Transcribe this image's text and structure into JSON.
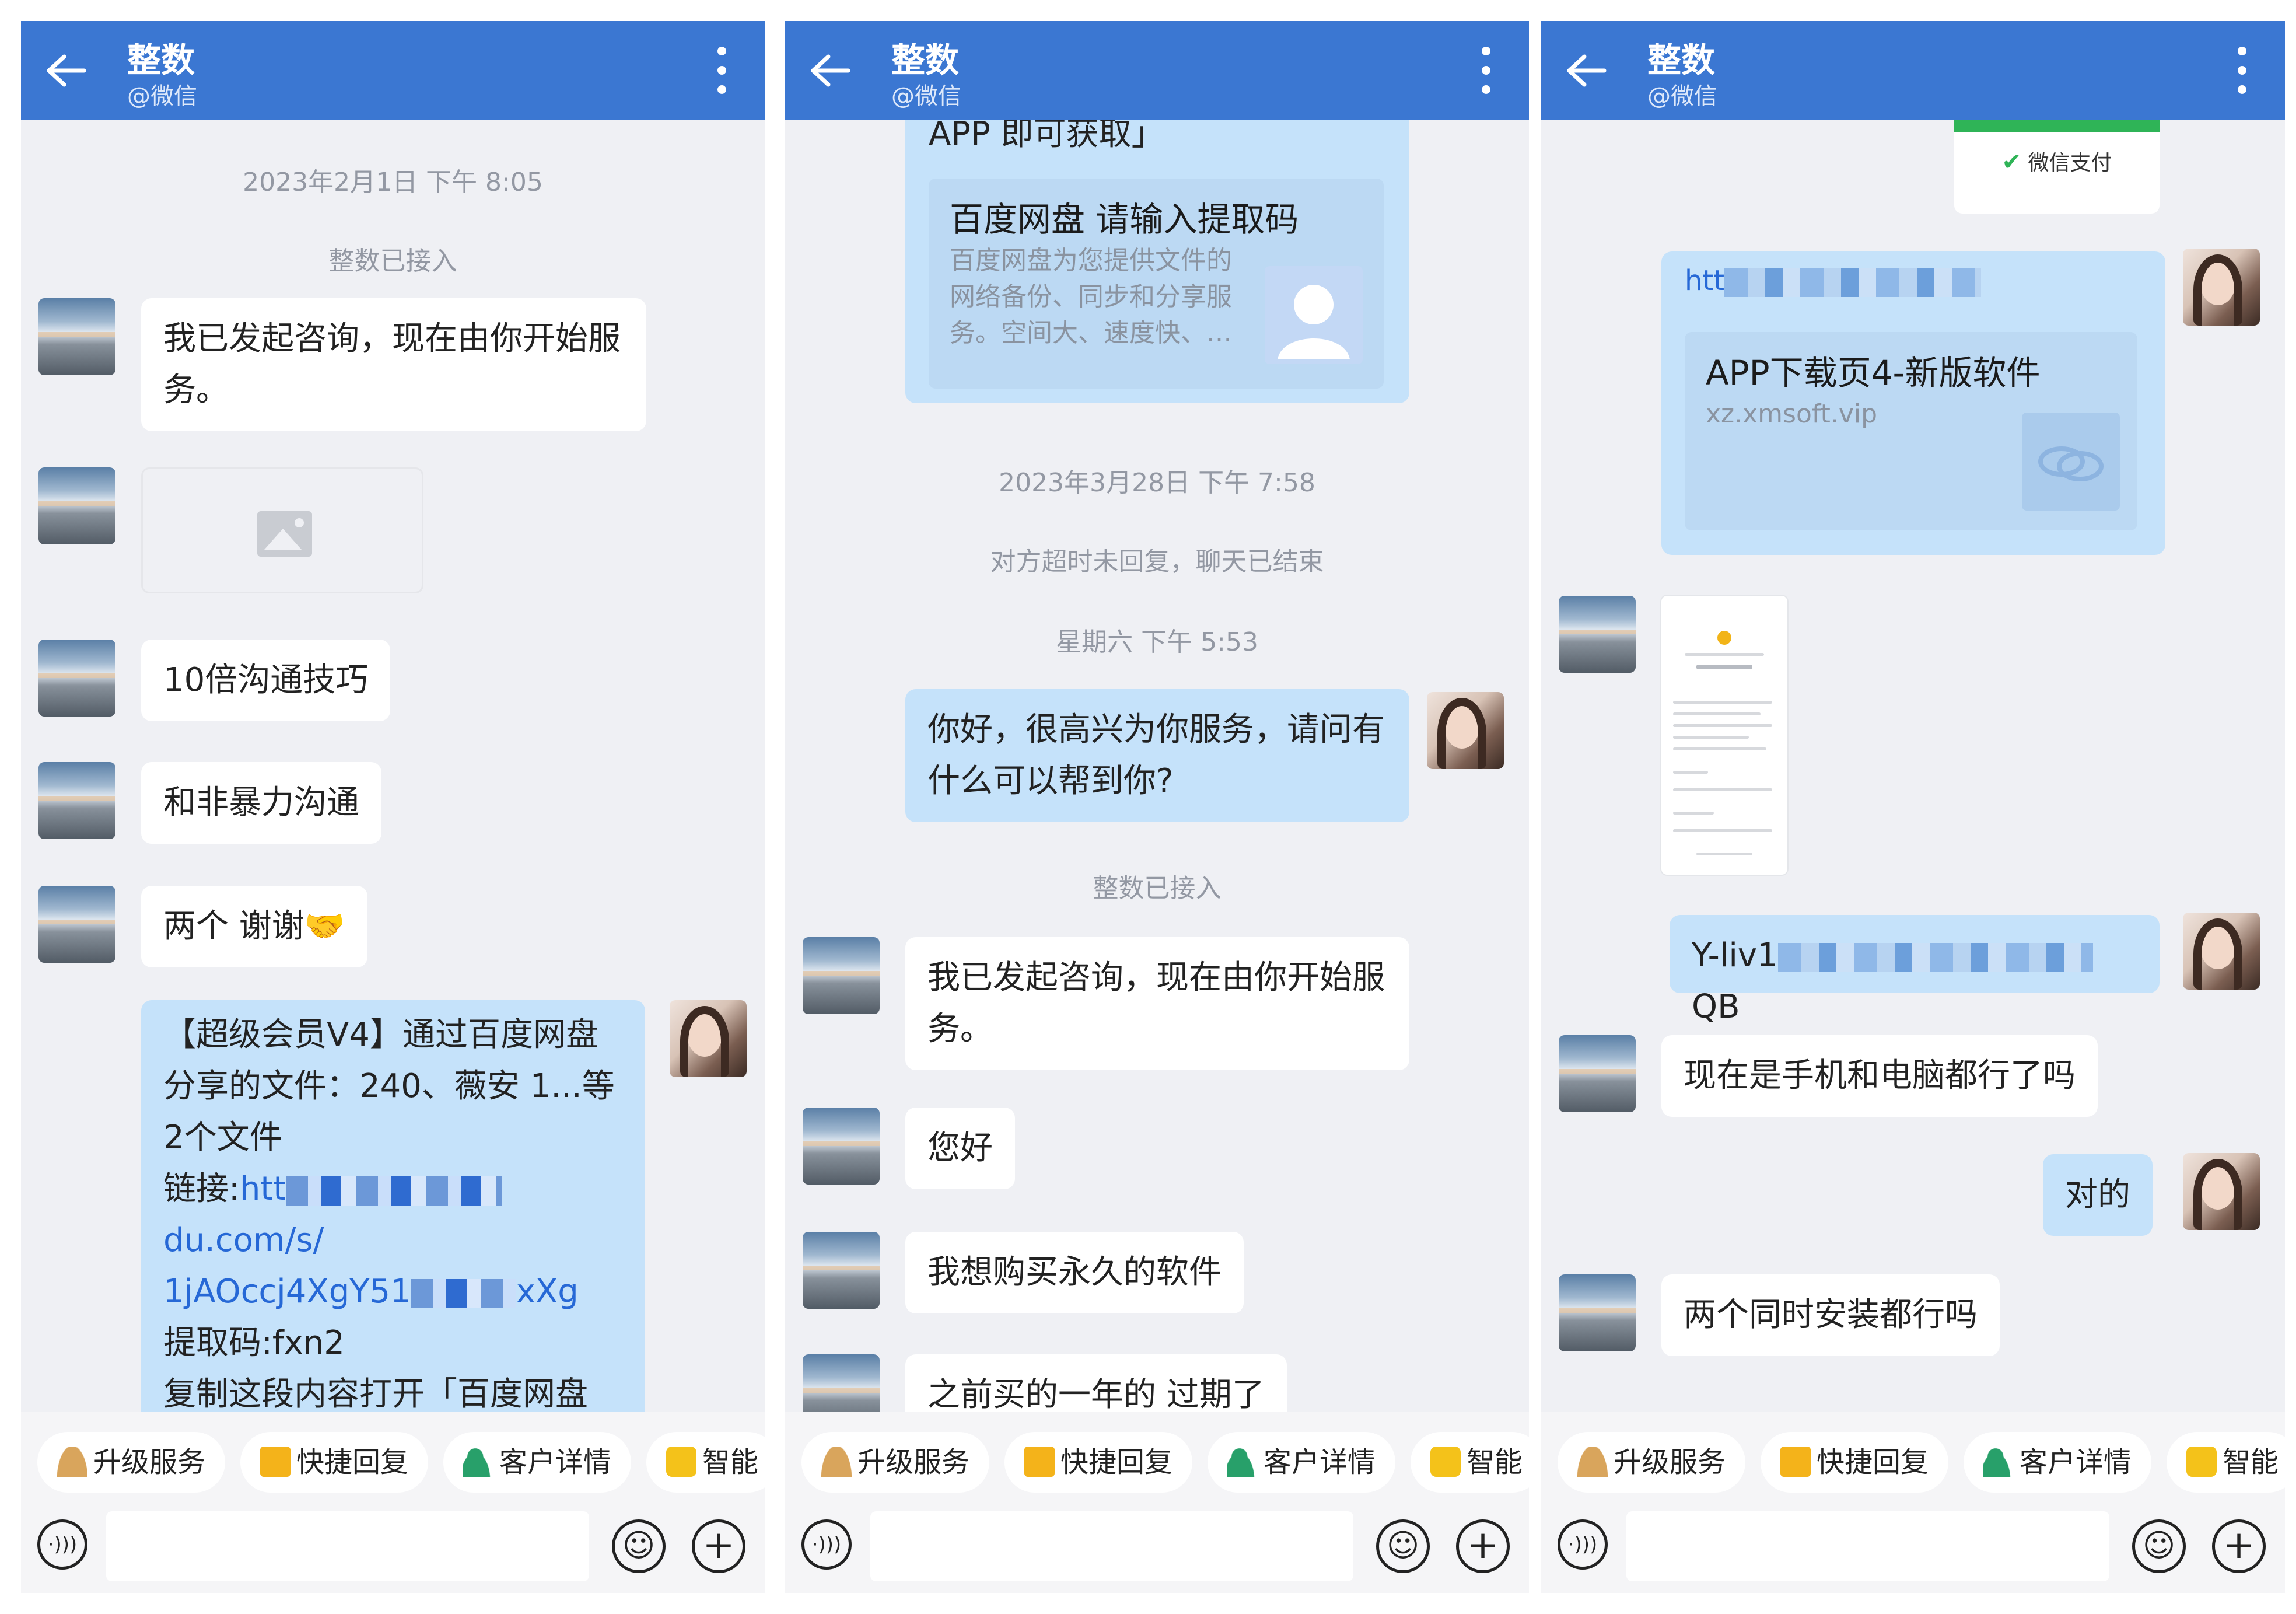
{
  "header": {
    "title": "整数",
    "subtitle": "@微信"
  },
  "toolbar": {
    "buttons": [
      {
        "label": "升级服务",
        "icon": "person-icon"
      },
      {
        "label": "快捷回复",
        "icon": "message-icon"
      },
      {
        "label": "客户详情",
        "icon": "user-detail-icon"
      },
      {
        "label": "智能",
        "icon": "robot-icon"
      }
    ]
  },
  "panel1": {
    "time": "2023年2月1日  下午 8:05",
    "joined": "整数已接入",
    "msg1": "我已发起咨询，现在由你开始服务。",
    "msg2": "10倍沟通技巧",
    "msg3": "和非暴力沟通",
    "msg4": "两个 谢谢🤝",
    "share": {
      "line1": "【超级会员V4】通过百度网盘分享的文件：240、薇安 1...等2个文件",
      "link_label": "链接:",
      "link_start": "htt",
      "link_mid": "du.com/s/",
      "link_end_a": "1jAOccj4XgY51",
      "link_end_b": "xXg",
      "code": "提取码:fxn2",
      "tail": "复制这段内容打开「百度网盘APP 即可获取」"
    }
  },
  "panel2": {
    "app_tail": "APP 即可获取」",
    "card": {
      "title": "百度网盘 请输入提取码",
      "desc": "百度网盘为您提供文件的网络备份、同步和分享服务。空间大、速度快、…"
    },
    "time1": "2023年3月28日  下午 7:58",
    "ended": "对方超时未回复，聊天已结束",
    "time2": "星期六  下午 5:53",
    "greet": "你好，很高兴为你服务，请问有什么可以帮到你?",
    "joined": "整数已接入",
    "msg1": "我已发起咨询，现在由你开始服务。",
    "msg2": "您好",
    "msg3": "我想购买永久的软件",
    "msg4": "之前买的一年的 过期了"
  },
  "panel3": {
    "wechat_pay": "微信支付",
    "link_card": {
      "url_prefix": "htt",
      "title": "APP下载页4-新版软件",
      "domain": "xz.xmsoft.vip"
    },
    "code_start": "Y-liv1",
    "code_end": "QB",
    "msg1": "现在是手机和电脑都行了吗",
    "reply": "对的",
    "msg2": "两个同时安装都行吗"
  }
}
